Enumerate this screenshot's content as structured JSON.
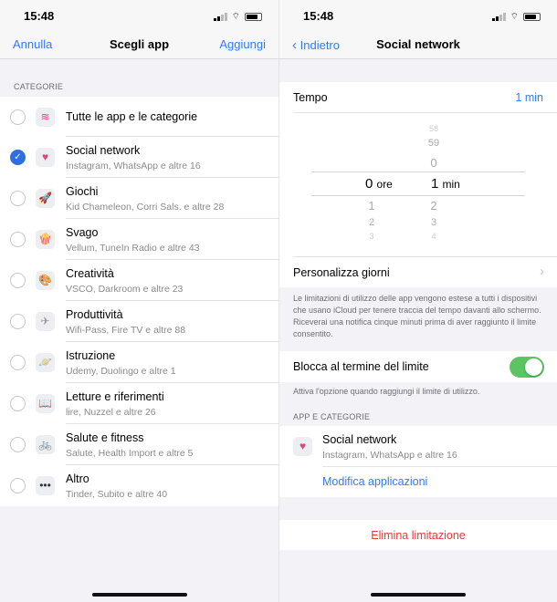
{
  "status": {
    "time": "15:48"
  },
  "left": {
    "nav": {
      "cancel": "Annulla",
      "title": "Scegli app",
      "add": "Aggiungi"
    },
    "section_header": "CATEGORIE",
    "items": [
      {
        "title": "Tutte le app e le categorie",
        "subtitle": "",
        "icon": "stack-icon",
        "glyph": "≋",
        "color": "#e0457a",
        "selected": false
      },
      {
        "title": "Social network",
        "subtitle": "Instagram, WhatsApp e altre 16",
        "icon": "chat-heart-icon",
        "glyph": "♥",
        "color": "#e0457a",
        "selected": true
      },
      {
        "title": "Giochi",
        "subtitle": "Kid Chameleon, Corri Sals. e altre 28",
        "icon": "rocket-icon",
        "glyph": "🚀",
        "color": "#4a90e2",
        "selected": false
      },
      {
        "title": "Svago",
        "subtitle": "Vellum, TuneIn Radio e altre 43",
        "icon": "popcorn-icon",
        "glyph": "🍿",
        "color": "#e0453a",
        "selected": false
      },
      {
        "title": "Creatività",
        "subtitle": "VSCO, Darkroom e altre 23",
        "icon": "palette-icon",
        "glyph": "🎨",
        "color": "#f0a030",
        "selected": false
      },
      {
        "title": "Produttività",
        "subtitle": "Wifi-Pass, Fire TV e altre 88",
        "icon": "paper-plane-icon",
        "glyph": "✈",
        "color": "#999",
        "selected": false
      },
      {
        "title": "Istruzione",
        "subtitle": "Udemy, Duolingo e altre 1",
        "icon": "planet-icon",
        "glyph": "🪐",
        "color": "#e0457a",
        "selected": false
      },
      {
        "title": "Letture e riferimenti",
        "subtitle": "lire, Nuzzel e altre 26",
        "icon": "book-icon",
        "glyph": "📖",
        "color": "#4a90e2",
        "selected": false
      },
      {
        "title": "Salute e fitness",
        "subtitle": "Salute, Health Import e altre 5",
        "icon": "bicycle-icon",
        "glyph": "🚲",
        "color": "#4a90e2",
        "selected": false
      },
      {
        "title": "Altro",
        "subtitle": "Tinder, Subito e altre 40",
        "icon": "more-icon",
        "glyph": "•••",
        "color": "#333",
        "selected": false
      }
    ]
  },
  "right": {
    "nav": {
      "back": "Indietro",
      "title": "Social network"
    },
    "time_label": "Tempo",
    "time_value": "1 min",
    "picker": {
      "hours_above": [],
      "minutes_above": [
        "58",
        "59",
        "0"
      ],
      "hours_selected": "0",
      "hours_unit": "ore",
      "minutes_selected": "1",
      "minutes_unit": "min",
      "hours_below": [
        "1",
        "2",
        "3"
      ],
      "minutes_below": [
        "2",
        "3",
        "4"
      ]
    },
    "customize_days": "Personalizza giorni",
    "info_text": "Le limitazioni di utilizzo delle app vengono estese a tutti i dispositivi che usano iCloud per tenere traccia del tempo davanti allo schermo. Riceverai una notifica cinque minuti prima di aver raggiunto il limite consentito.",
    "block_label": "Blocca al termine del limite",
    "block_enabled": true,
    "block_footer": "Attiva l'opzione quando raggiungi il limite di utilizzo.",
    "apps_header": "APP E CATEGORIE",
    "app": {
      "title": "Social network",
      "subtitle": "Instagram, WhatsApp e altre 16"
    },
    "edit_apps": "Modifica applicazioni",
    "delete": "Elimina limitazione",
    "colors": {
      "accent": "#2f7bf5",
      "destructive": "#e5393a",
      "toggle": "#5ac561"
    }
  }
}
